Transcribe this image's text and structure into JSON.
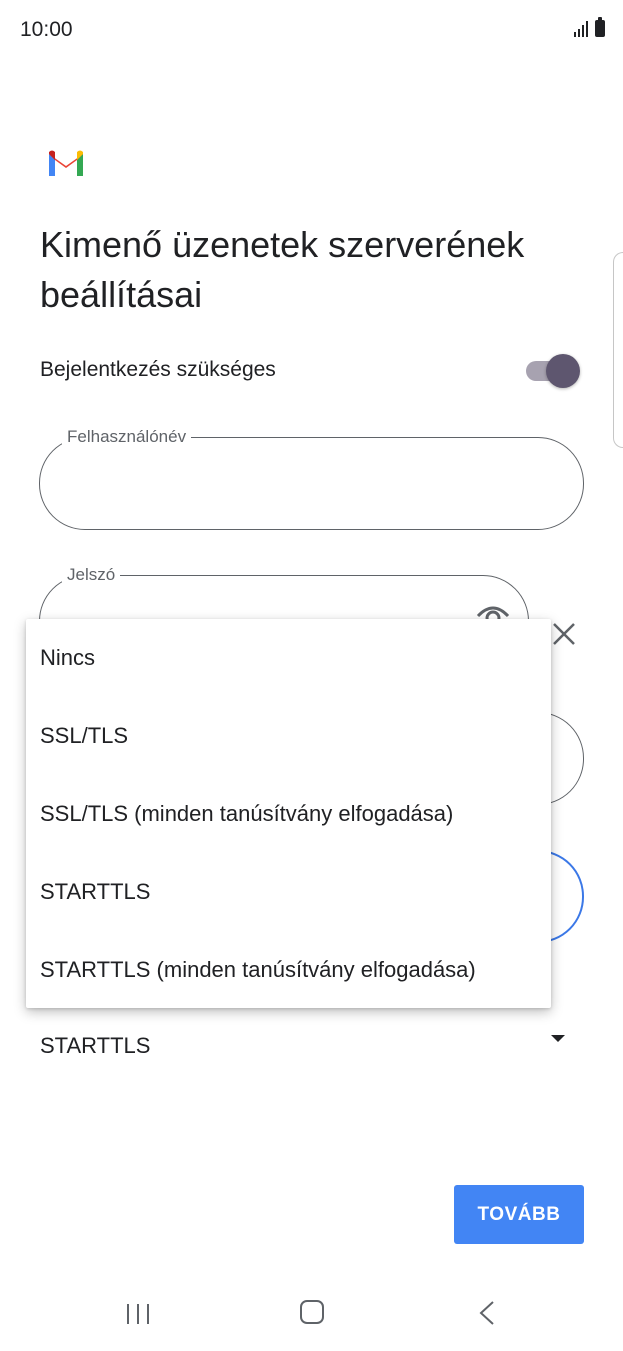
{
  "status_bar": {
    "time": "10:00"
  },
  "app": {
    "logo": "gmail-logo",
    "title": "Kimenő üzenetek szerverének beállításai"
  },
  "login_required": {
    "label": "Bejelentkezés szükséges",
    "enabled": true
  },
  "username_field": {
    "label": "Felhasználónév",
    "value": ""
  },
  "password_field": {
    "label": "Jelszó",
    "value": ""
  },
  "security_type": {
    "selected": "STARTTLS",
    "options": [
      "Nincs",
      "SSL/TLS",
      "SSL/TLS (minden tanúsítvány elfogadása)",
      "STARTTLS",
      "STARTTLS (minden tanúsítvány elfogadása)"
    ]
  },
  "next_button": {
    "label": "TOVÁBB"
  },
  "colors": {
    "primary": "#4285f4",
    "toggle_thumb": "#5e566f",
    "text": "#202124"
  }
}
